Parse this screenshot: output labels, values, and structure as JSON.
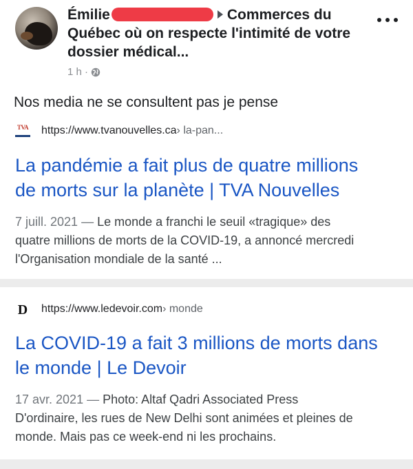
{
  "post": {
    "author_first": "Émilie",
    "group_name": "Commerces du Québec où on respecte l'intimité de votre dossier médical...",
    "time": "1 h ·",
    "body_text": "Nos media ne se consultent pas je pense"
  },
  "results": [
    {
      "favicon": "TVA",
      "url_base": "https://www.tvanouvelles.ca",
      "url_path": " › la-pan...",
      "title_line1": "La pandémie a fait plus de quatre millions",
      "title_line2": "de morts sur la planète | TVA Nouvelles",
      "date": "7 juill. 2021 —",
      "snippet_line1": " Le monde a franchi le seuil «tragique» des",
      "snippet_line2": "quatre millions de morts de la COVID-19, a annoncé mercredi",
      "snippet_line3": "l'Organisation mondiale de la santé ..."
    },
    {
      "favicon": "D",
      "url_base": "https://www.ledevoir.com",
      "url_path": " › monde",
      "title_line1": "La COVID-19 a fait 3 millions de morts dans",
      "title_line2": "le monde | Le Devoir",
      "date": "17 avr. 2021 —",
      "snippet_line1": " Photo: Altaf Qadri Associated Press",
      "snippet_line2": "D'ordinaire, les rues de New Delhi sont animées et pleines de",
      "snippet_line3": "monde. Mais pas ce week-end ni les prochains."
    }
  ],
  "icons": {
    "globe": "globe-icon",
    "more": "more-options-icon",
    "arrow": "arrow-right-icon"
  },
  "colors": {
    "link": "#1a56c4",
    "redaction": "#ee3b46"
  }
}
